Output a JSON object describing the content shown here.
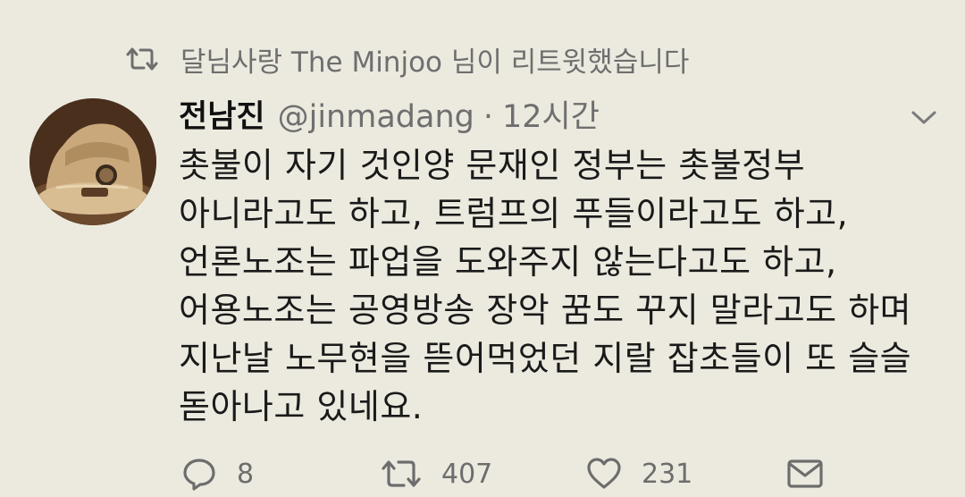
{
  "retweet_banner": {
    "icon": "retweet-icon",
    "text": "달님사랑 The Minjoo 님이 리트윗했습니다"
  },
  "tweet": {
    "display_name": "전남진",
    "handle": "@jinmadang",
    "separator": "·",
    "time": "12시간",
    "menu_icon": "chevron-down-icon",
    "lines": [
      "촛불이 자기 것인양 문재인 정부는 촛불정부",
      "아니라고도 하고, 트럼프의 푸들이라고도 하고,",
      "언론노조는 파업을 도와주지 않는다고도 하고,",
      "어용노조는 공영방송 장악 꿈도 꾸지 말라고도 하며",
      "지난날 노무현을 뜯어먹었던 지랄 잡초들이 또 슬슬",
      "돋아나고 있네요."
    ]
  },
  "actions": {
    "reply": {
      "icon": "reply-icon",
      "count": "8"
    },
    "retweet": {
      "icon": "retweet-icon",
      "count": "407"
    },
    "like": {
      "icon": "heart-icon",
      "count": "231"
    },
    "dm": {
      "icon": "mail-icon"
    }
  },
  "colors": {
    "background": "#eceadf",
    "text": "#1a1a1a",
    "secondary": "#6e6e6e"
  }
}
